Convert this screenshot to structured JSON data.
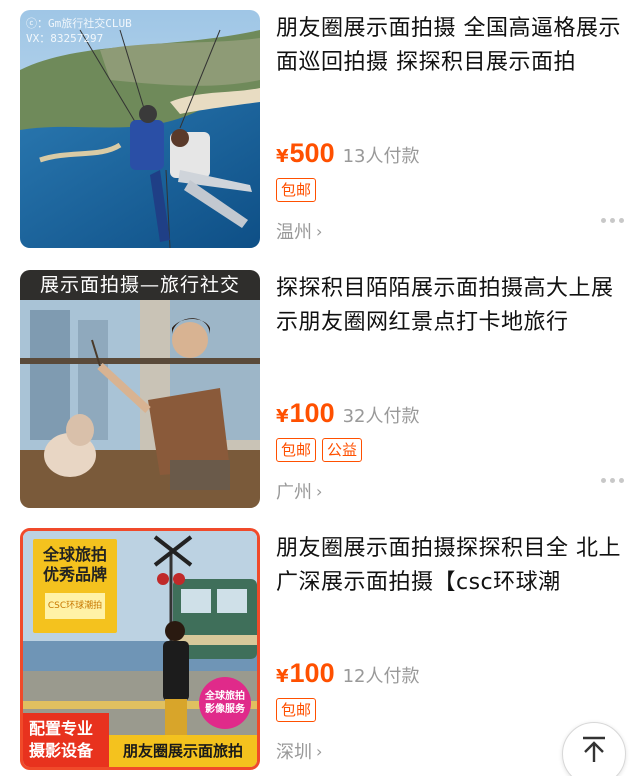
{
  "products": [
    {
      "title": "朋友圈展示面拍摄 全国高逼格展示面巡回拍摄 探探积目展示面拍",
      "currency": "¥",
      "price": "500",
      "paid": "13人付款",
      "tags": [
        "包邮"
      ],
      "city": "温州",
      "image": {
        "watermark_line1": "ⓒ：Gm旅行社交CLUB",
        "watermark_line2": "VX：83257297",
        "scene": "paragliding-over-coast"
      }
    },
    {
      "title": "探探积目陌陌展示面拍摄高大上展示朋友圈网红景点打卡地旅行",
      "currency": "¥",
      "price": "100",
      "paid": "32人付款",
      "tags": [
        "包邮",
        "公益"
      ],
      "city": "广州",
      "image": {
        "banner": "展示面拍摄—旅行社交",
        "scene": "man-feeding-dog-in-cafe"
      }
    },
    {
      "title": "朋友圈展示面拍摄探探积目全 北上广深展示面拍摄【csc环球潮",
      "currency": "¥",
      "price": "100",
      "paid": "12人付款",
      "tags": [
        "包邮"
      ],
      "city": "深圳",
      "image": {
        "badge_line1": "全球旅拍",
        "badge_line2": "优秀品牌",
        "card_text": "CSC环球潮拍",
        "circle_line1": "全球旅拍",
        "circle_line2": "影像服务",
        "bottom_left_line1": "配置专业",
        "bottom_left_line2": "摄影设备",
        "bottom_right": "朋友圈展示面旅拍",
        "scene": "train-crossing-by-sea"
      }
    }
  ],
  "back_to_top_icon": "arrow-up-to-top-icon",
  "colors": {
    "price": "#ff5000",
    "meta": "#999999",
    "thumb3_border": "#f04a2a"
  }
}
